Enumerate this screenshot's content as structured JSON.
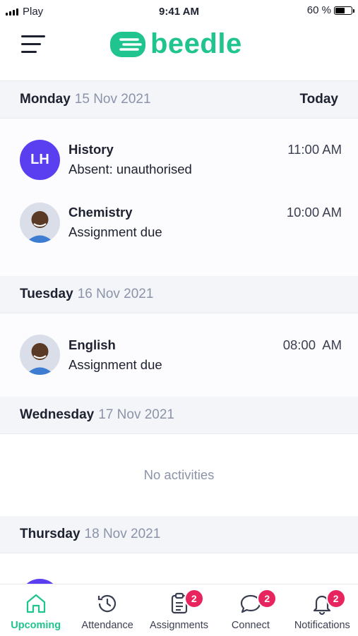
{
  "status_bar": {
    "carrier": "Play",
    "time": "9:41 AM",
    "battery": "60 %",
    "battery_level": 0.6
  },
  "header": {
    "logo_text": "beedle",
    "brand_color": "#1fc48e"
  },
  "days": {
    "monday": {
      "name": "Monday",
      "date": "15 Nov 2021",
      "tag": "Today"
    },
    "tuesday": {
      "name": "Tuesday",
      "date": "16 Nov 2021"
    },
    "wednesday": {
      "name": "Wednesday",
      "date": "17 Nov 2021",
      "empty_text": "No activities"
    },
    "thursday": {
      "name": "Thursday",
      "date": "18 Nov 2021"
    }
  },
  "activities": {
    "history": {
      "avatar_initials": "LH",
      "subject": "History",
      "description": "Absent: unauthorised",
      "time": "11:00 AM"
    },
    "chemistry": {
      "subject": "Chemistry",
      "description": "Assignment due",
      "time": "10:00 AM"
    },
    "english": {
      "subject": "English",
      "description": "Assignment due",
      "time": "08:00  AM"
    }
  },
  "tabs": {
    "upcoming": {
      "label": "Upcoming",
      "icon": "home-icon"
    },
    "attendance": {
      "label": "Attendance",
      "icon": "history-icon"
    },
    "assignments": {
      "label": "Assignments",
      "icon": "clipboard-icon",
      "badge": "2"
    },
    "connect": {
      "label": "Connect",
      "icon": "chat-icon",
      "badge": "2"
    },
    "notifications": {
      "label": "Notifications",
      "icon": "bell-icon",
      "badge": "2"
    }
  },
  "colors": {
    "accent": "#1fc48e",
    "avatar": "#5a3ff0",
    "badge": "#e8245e"
  }
}
